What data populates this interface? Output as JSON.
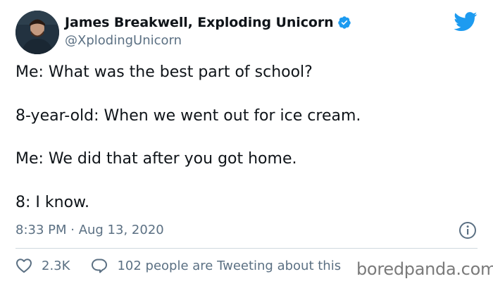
{
  "author": {
    "display_name": "James Breakwell, Exploding Unicorn",
    "handle": "@XplodingUnicorn",
    "verified": true
  },
  "tweet": {
    "lines": [
      "Me: What was the best part of school?",
      "8-year-old: When we went out for ice cream.",
      "Me: We did that after you got home.",
      "8: I know."
    ],
    "timestamp": "8:33 PM · Aug 13, 2020"
  },
  "engagement": {
    "likes": "2.3K",
    "conversation": "102 people are Tweeting about this"
  },
  "watermark": "boredpanda.com",
  "colors": {
    "twitter_blue": "#1d9bf0",
    "text_primary": "#0f1419",
    "text_secondary": "#5b7083",
    "divider": "#cfd9de"
  },
  "icons": {
    "verified": "verified-badge-icon",
    "brand": "twitter-bird-icon",
    "info": "info-icon",
    "like": "heart-icon",
    "reply": "speech-bubble-icon"
  }
}
